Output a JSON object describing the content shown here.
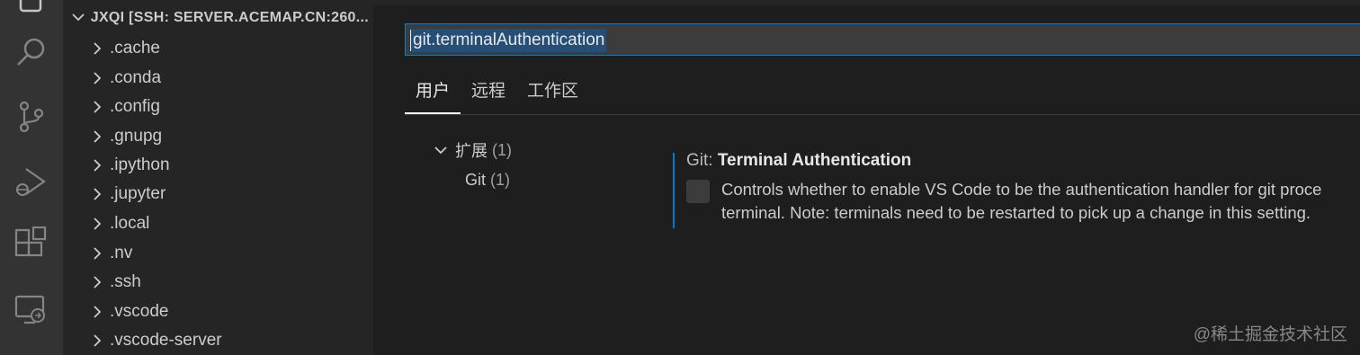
{
  "activity_bar": {
    "icons": [
      "explorer-icon",
      "search-icon",
      "source-control-icon",
      "run-debug-icon",
      "extensions-icon",
      "remote-explorer-icon"
    ]
  },
  "sidebar": {
    "header": "JXQI [SSH: SERVER.ACEMAP.CN:260...",
    "items": [
      ".cache",
      ".conda",
      ".config",
      ".gnupg",
      ".ipython",
      ".jupyter",
      ".local",
      ".nv",
      ".ssh",
      ".vscode",
      ".vscode-server"
    ]
  },
  "settings": {
    "search_value": "git.terminalAuthentication",
    "tabs": [
      "用户",
      "远程",
      "工作区"
    ],
    "toc": {
      "group_label": "扩展",
      "group_count": "(1)",
      "child_label": "Git",
      "child_count": "(1)"
    },
    "item": {
      "category": "Git: ",
      "name": "Terminal Authentication",
      "description_line1": "Controls whether to enable VS Code to be the authentication handler for git proce",
      "description_line2": "terminal. Note: terminals need to be restarted to pick up a change in this setting.",
      "checked": false
    }
  },
  "watermark": "@稀土掘金技术社区",
  "colors": {
    "accent": "#007acc",
    "selection": "#264f78"
  }
}
